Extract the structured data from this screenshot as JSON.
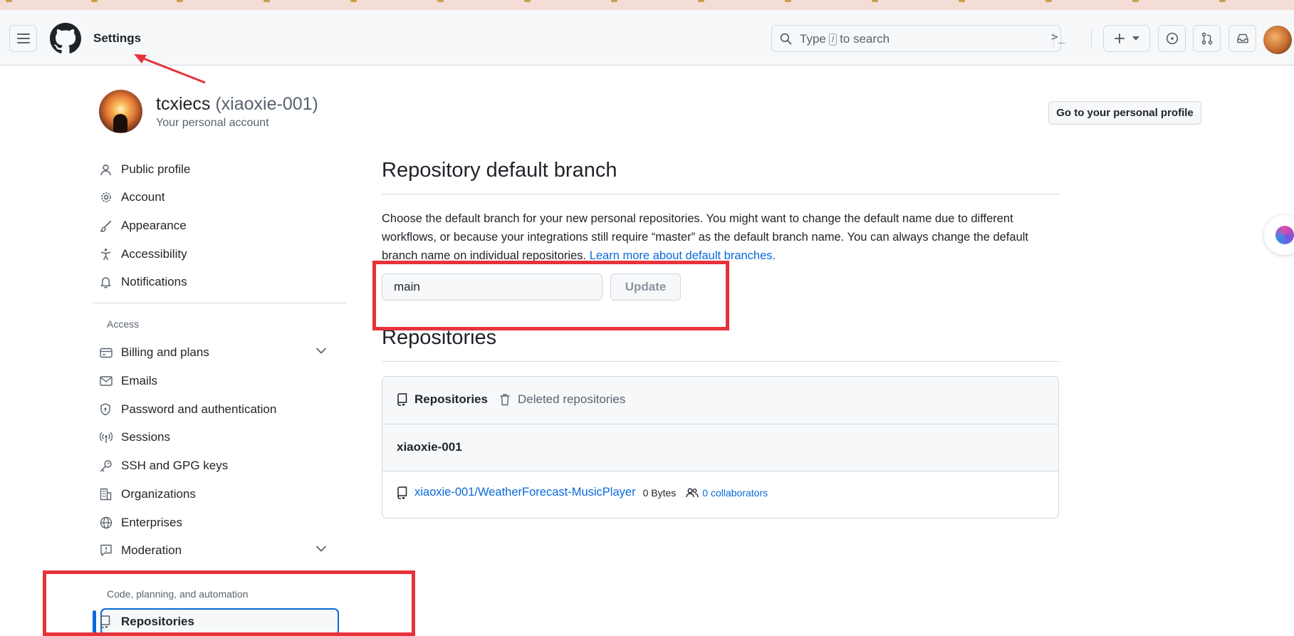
{
  "header": {
    "title": "Settings",
    "search": {
      "before": "Type",
      "key": "/",
      "after": "to search"
    },
    "command_glyph": ">_"
  },
  "user": {
    "name": "tcxiecs",
    "handle": "(xiaoxie-001)",
    "subtitle": "Your personal account",
    "profile_button": "Go to your personal profile"
  },
  "sidebar": {
    "items": [
      {
        "label": "Public profile",
        "icon": "person-icon"
      },
      {
        "label": "Account",
        "icon": "gear-icon"
      },
      {
        "label": "Appearance",
        "icon": "paintbrush-icon"
      },
      {
        "label": "Accessibility",
        "icon": "accessibility-icon"
      },
      {
        "label": "Notifications",
        "icon": "bell-icon"
      }
    ],
    "access_heading": "Access",
    "access_items": [
      {
        "label": "Billing and plans",
        "icon": "credit-card-icon",
        "expandable": true
      },
      {
        "label": "Emails",
        "icon": "mail-icon"
      },
      {
        "label": "Password and authentication",
        "icon": "shield-lock-icon"
      },
      {
        "label": "Sessions",
        "icon": "broadcast-icon"
      },
      {
        "label": "SSH and GPG keys",
        "icon": "key-icon"
      },
      {
        "label": "Organizations",
        "icon": "organization-icon"
      },
      {
        "label": "Enterprises",
        "icon": "globe-icon"
      },
      {
        "label": "Moderation",
        "icon": "report-icon",
        "expandable": true
      }
    ],
    "code_heading": "Code, planning, and automation",
    "code_items": [
      {
        "label": "Repositories",
        "icon": "repo-icon",
        "active": true
      }
    ]
  },
  "default_branch": {
    "heading": "Repository default branch",
    "description": "Choose the default branch for your new personal repositories. You might want to change the default name due to different workflows, or because your integrations still require “master” as the default branch name. You can always change the default branch name on individual repositories.",
    "learn_more": "Learn more about default branches.",
    "input_value": "main",
    "update_button": "Update"
  },
  "repositories": {
    "heading": "Repositories",
    "tabs": {
      "active": "Repositories",
      "deleted": "Deleted repositories"
    },
    "owner": "xiaoxie-001",
    "rows": [
      {
        "name": "xiaoxie-001/WeatherForecast-MusicPlayer",
        "size": "0 Bytes",
        "collaborators": "0 collaborators"
      }
    ]
  },
  "colors": {
    "accent": "#0969da",
    "annotation": "#e8323a",
    "text": "#1f2328",
    "muted": "#59636e"
  }
}
